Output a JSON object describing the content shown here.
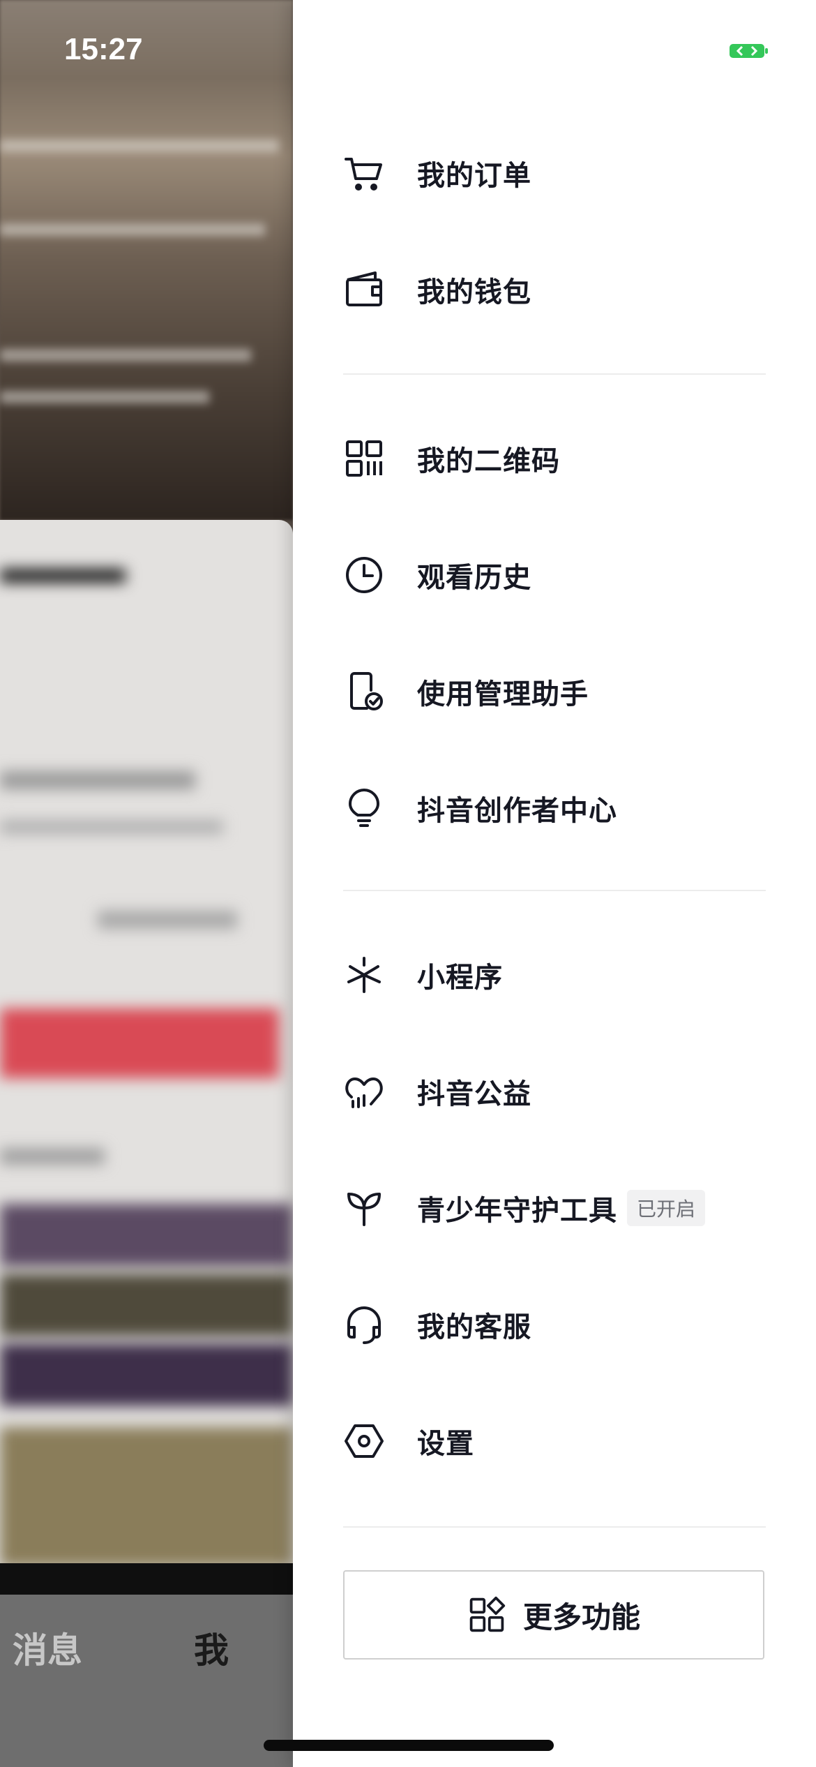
{
  "status_bar": {
    "time": "15:27",
    "battery_color": "#34c759"
  },
  "background_tabs": [
    {
      "label": "消息",
      "active": false
    },
    {
      "label": "我",
      "active": true
    }
  ],
  "drawer": {
    "sections": [
      [
        {
          "icon": "cart-icon",
          "label": "我的订单"
        },
        {
          "icon": "wallet-icon",
          "label": "我的钱包"
        }
      ],
      [
        {
          "icon": "qrcode-icon",
          "label": "我的二维码"
        },
        {
          "icon": "clock-icon",
          "label": "观看历史"
        },
        {
          "icon": "phone-check-icon",
          "label": "使用管理助手"
        },
        {
          "icon": "lightbulb-icon",
          "label": "抖音创作者中心"
        }
      ],
      [
        {
          "icon": "mini-program-icon",
          "label": "小程序"
        },
        {
          "icon": "heart-charity-icon",
          "label": "抖音公益"
        },
        {
          "icon": "sprout-icon",
          "label": "青少年守护工具",
          "badge": "已开启"
        },
        {
          "icon": "headset-icon",
          "label": "我的客服"
        },
        {
          "icon": "settings-hexagon-icon",
          "label": "设置"
        }
      ]
    ],
    "more_button": {
      "icon": "grid-icon",
      "label": "更多功能"
    }
  }
}
